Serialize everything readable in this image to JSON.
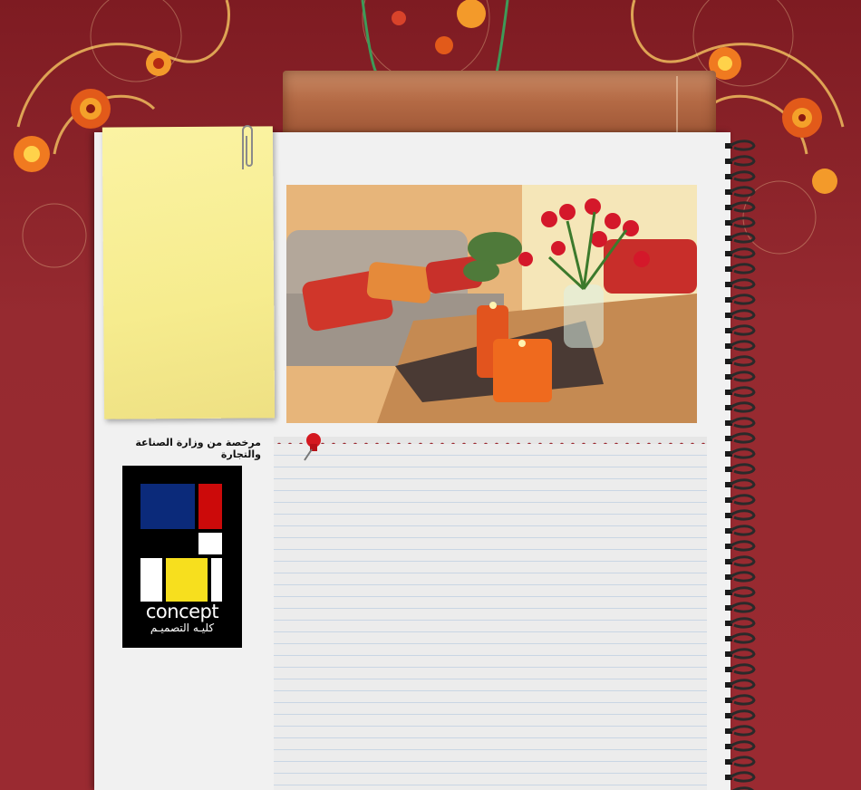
{
  "sidebar": {
    "license_text": "مرخصة من وزارة الصناعة والتجارة",
    "logo": {
      "word": "concept",
      "arabic": "كليـه التصميـم"
    }
  },
  "main": {
    "hero_image": "living-room-candles-tulips-photo"
  },
  "colors": {
    "background": "#962a30",
    "sticky_note": "#f6ec8e",
    "logo_blue": "#0b2a7a",
    "logo_red": "#cc0a0a",
    "logo_yellow": "#f7df1e"
  }
}
